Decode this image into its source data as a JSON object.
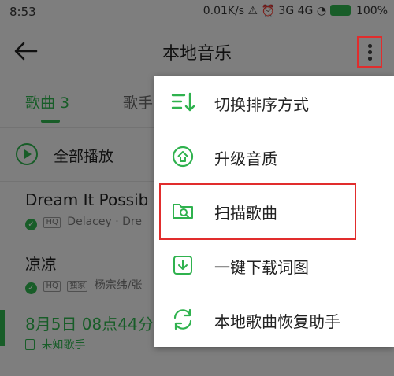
{
  "status_bar": {
    "time": "8:53",
    "right_text": "0.01K/s ⚠ ⏰ 3G 4G",
    "battery_percent": "100%"
  },
  "app_bar": {
    "title": "本地音乐"
  },
  "tabs": {
    "songs_label": "歌曲 3",
    "singers_label": "歌手"
  },
  "play_all": {
    "label": "全部播放"
  },
  "songs": [
    {
      "title": "Dream It Possib",
      "quality": "HQ",
      "artist": "Delacey · Dre"
    },
    {
      "title": "凉凉",
      "quality": "HQ",
      "tag": "独家",
      "artist": "杨宗纬/张"
    },
    {
      "title": "8月5日 08点44分",
      "artist": "未知歌手"
    }
  ],
  "menu": {
    "items": [
      {
        "label": "切换排序方式",
        "icon": "sort-icon"
      },
      {
        "label": "升级音质",
        "icon": "upgrade-icon"
      },
      {
        "label": "扫描歌曲",
        "icon": "scan-folder-icon"
      },
      {
        "label": "一键下载词图",
        "icon": "download-icon"
      },
      {
        "label": "本地歌曲恢复助手",
        "icon": "restore-icon"
      }
    ]
  },
  "colors": {
    "accent": "#2fb24e",
    "highlight_box": "#e12d2d"
  }
}
